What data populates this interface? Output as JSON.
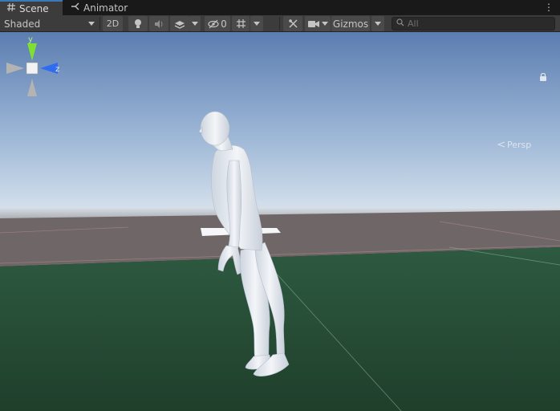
{
  "tabs": [
    {
      "label": "Scene",
      "icon": "hash-icon",
      "active": true
    },
    {
      "label": "Animator",
      "icon": "animator-icon",
      "active": false
    }
  ],
  "toolbar": {
    "shading_mode": "Shaded",
    "mode_2d": "2D",
    "hidden_count": "0",
    "gizmos_label": "Gizmos",
    "search_placeholder": "All"
  },
  "viewport": {
    "gizmo_axes": {
      "y": "y",
      "z": "z"
    },
    "projection_label": "Persp"
  },
  "colors": {
    "tab_accent": "#3a79bb",
    "axis_y": "#7fe032",
    "axis_z": "#2f6cf0",
    "sky_top": "#5d7fb1",
    "horizon": "#d8e3ee",
    "ground": "#23452f"
  }
}
